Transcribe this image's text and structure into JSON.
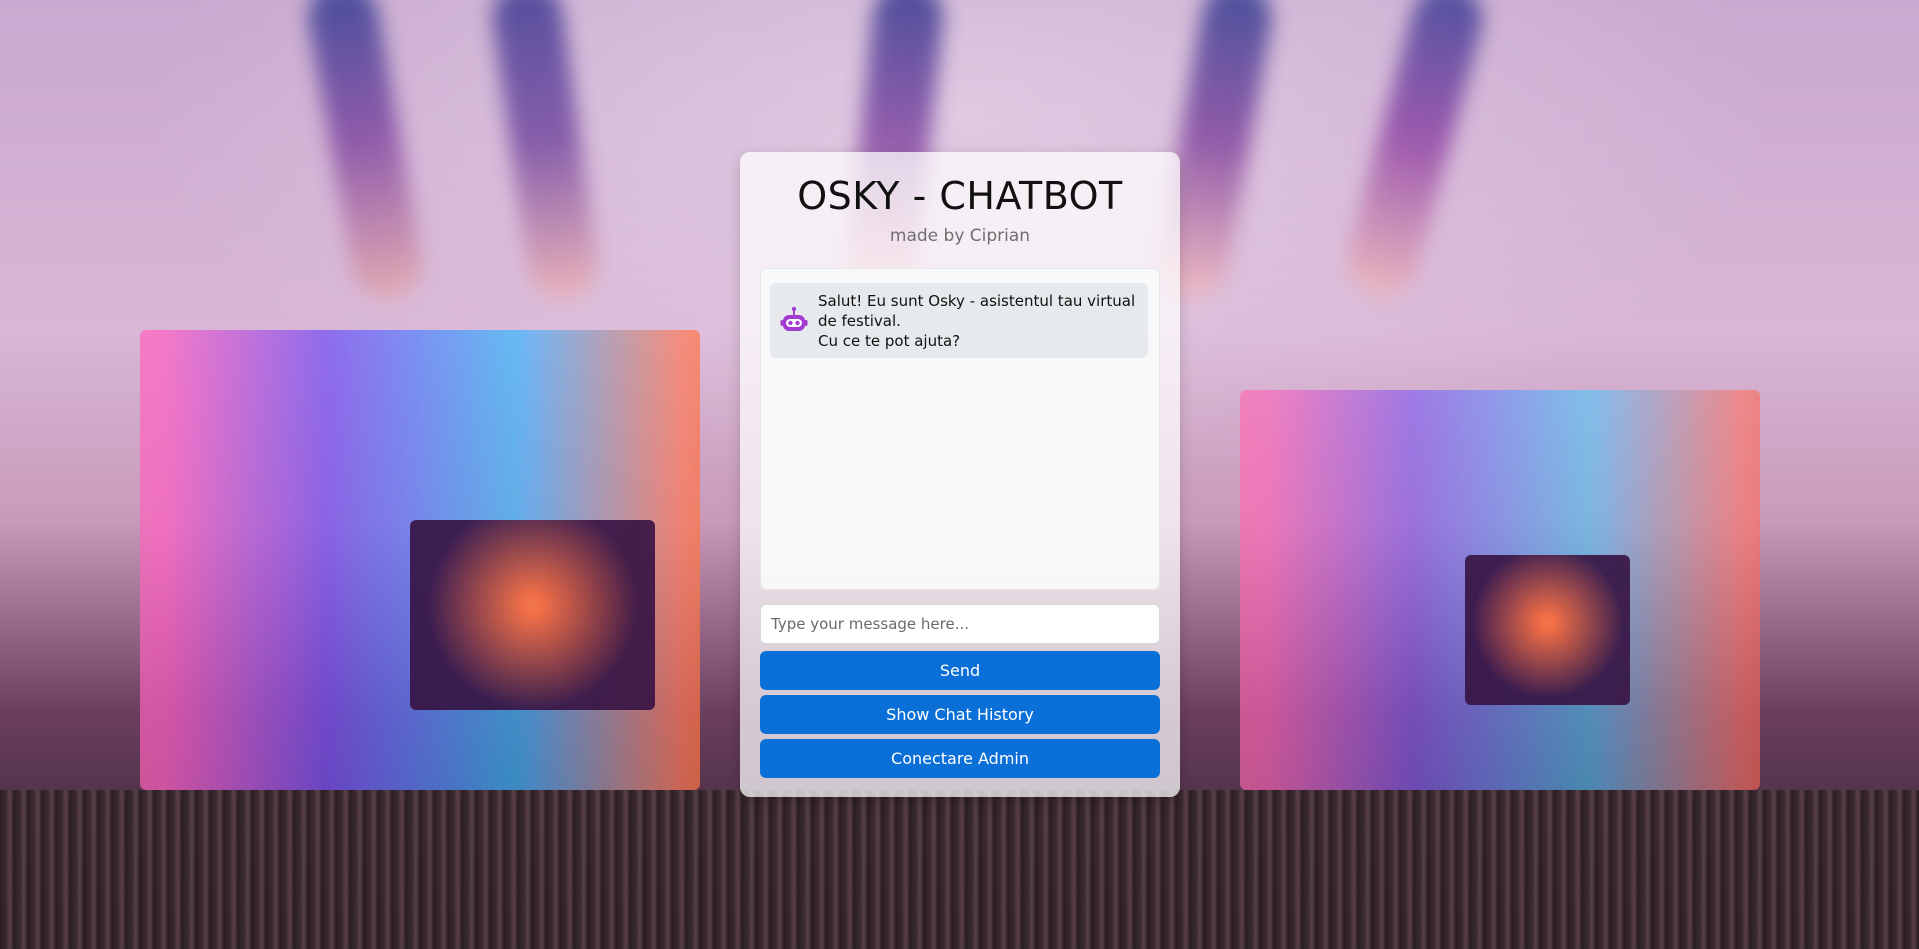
{
  "header": {
    "title": "OSKY - CHATBOT",
    "subtitle": "made by Ciprian"
  },
  "chat": {
    "messages": [
      {
        "sender": "bot",
        "icon": "robot-icon",
        "lines": [
          "Salut! Eu sunt Osky - asistentul tau virtual de festival.",
          "Cu ce te pot ajuta?"
        ]
      }
    ]
  },
  "composer": {
    "placeholder": "Type your message here..."
  },
  "buttons": {
    "send": "Send",
    "history": "Show Chat History",
    "admin": "Conectare Admin"
  },
  "colors": {
    "accent": "#0a6fd6",
    "bot_icon": "#a23bd1"
  }
}
